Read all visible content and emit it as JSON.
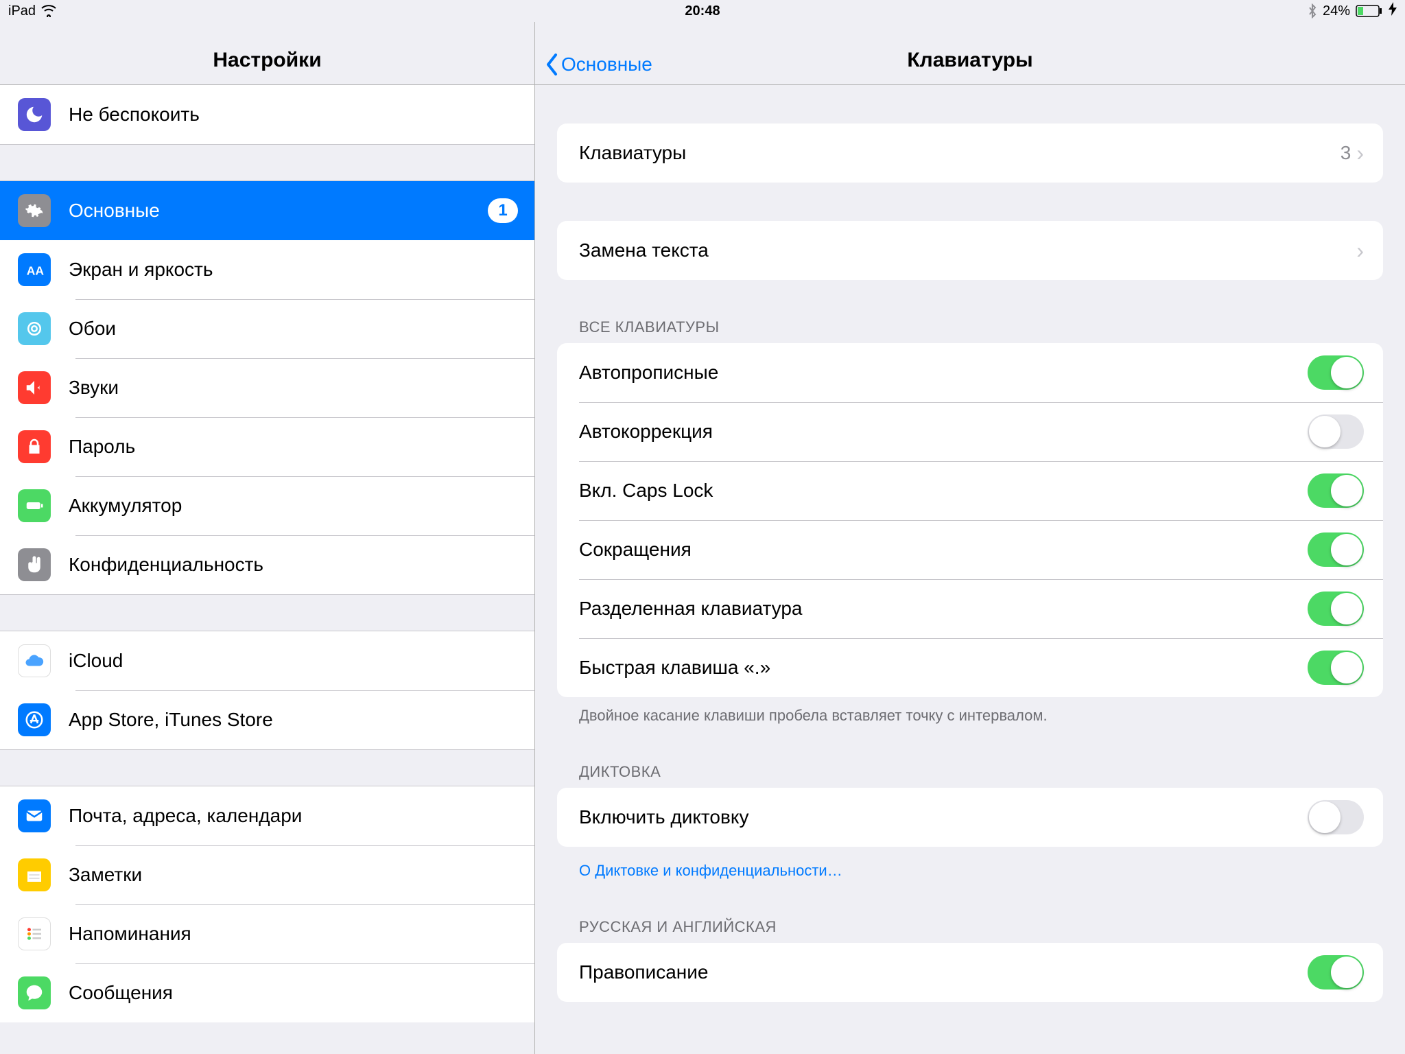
{
  "status": {
    "device": "iPad",
    "time": "20:48",
    "battery_text": "24%"
  },
  "sidebar": {
    "title": "Настройки",
    "items": {
      "dnd": "Не беспокоить",
      "general": "Основные",
      "general_badge": "1",
      "display": "Экран и яркость",
      "wallpaper": "Обои",
      "sounds": "Звуки",
      "passcode": "Пароль",
      "battery": "Аккумулятор",
      "privacy": "Конфиденциальность",
      "icloud": "iCloud",
      "stores": "App Store, iTunes Store",
      "mail": "Почта, адреса, календари",
      "notes": "Заметки",
      "reminders": "Напоминания",
      "messages": "Сообщения"
    }
  },
  "detail": {
    "back": "Основные",
    "title": "Клавиатуры",
    "keyboards_label": "Клавиатуры",
    "keyboards_count": "3",
    "text_replacement": "Замена текста",
    "section_all": "ВСЕ КЛАВИАТУРЫ",
    "toggles": {
      "auto_caps": "Автопрописные",
      "auto_correct": "Автокоррекция",
      "caps_lock": "Вкл. Caps Lock",
      "shortcuts": "Сокращения",
      "split_kb": "Разделенная клавиатура",
      "quick_period": "Быстрая клавиша «.»"
    },
    "toggle_states": {
      "auto_caps": true,
      "auto_correct": false,
      "caps_lock": true,
      "shortcuts": true,
      "split_kb": true,
      "quick_period": true,
      "dictation": false,
      "spelling": true
    },
    "footer_period": "Двойное касание клавиши пробела вставляет точку с интервалом.",
    "section_dictation": "ДИКТОВКА",
    "dictation_label": "Включить диктовку",
    "dictation_link": "О Диктовке и конфиденциальности…",
    "section_ru_en": "РУССКАЯ И АНГЛИЙСКАЯ",
    "spelling_label": "Правописание"
  }
}
